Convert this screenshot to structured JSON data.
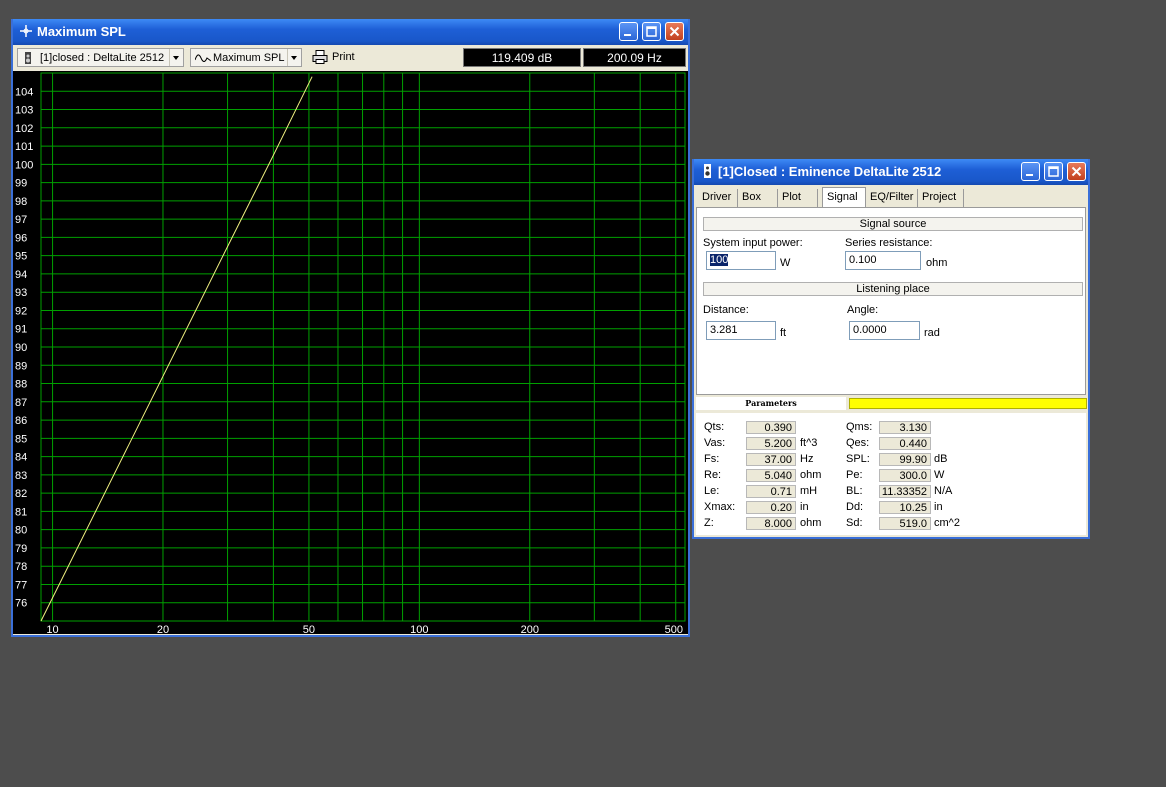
{
  "spl_window": {
    "title": "Maximum SPL",
    "title_icon": "crosshair-icon",
    "toolbar": {
      "driver_select": "[1]closed : DeltaLite 2512",
      "plot_select": "Maximum SPL",
      "print_label": "Print",
      "db_readout": "119.409 dB",
      "hz_readout": "200.09 Hz"
    }
  },
  "chart_data": {
    "type": "line",
    "title": "",
    "xlabel": "",
    "ylabel": "",
    "x_scale": "log",
    "xlim": [
      9.3,
      530
    ],
    "ylim": [
      75,
      105
    ],
    "x_tick_labels": [
      {
        "value": 10,
        "label": "10"
      },
      {
        "value": 20,
        "label": "20"
      },
      {
        "value": 50,
        "label": "50"
      },
      {
        "value": 100,
        "label": "100"
      },
      {
        "value": 200,
        "label": "200"
      },
      {
        "value": 500,
        "label": "500"
      }
    ],
    "y_ticks": [
      76,
      77,
      78,
      79,
      80,
      81,
      82,
      83,
      84,
      85,
      86,
      87,
      88,
      89,
      90,
      91,
      92,
      93,
      94,
      95,
      96,
      97,
      98,
      99,
      100,
      101,
      102,
      103,
      104
    ],
    "grid": true,
    "background": "#000000",
    "grid_color": "#00a000",
    "axis_text_color": "#ffffff",
    "series": [
      {
        "color": "#f0f080",
        "x": [
          9.3,
          20,
          30,
          40,
          51
        ],
        "y": [
          75,
          88.4,
          95.5,
          100.5,
          104.8
        ]
      }
    ]
  },
  "signal_window": {
    "title": "[1]Closed : Eminence  DeltaLite 2512",
    "title_icon": "speaker-icon",
    "tabs": [
      {
        "label": "Driver"
      },
      {
        "label": "Box"
      },
      {
        "label": "Plot"
      },
      {
        "label": "Signal",
        "active": true
      },
      {
        "label": "EQ/Filter"
      },
      {
        "label": "Project"
      }
    ],
    "signal_source": {
      "header": "Signal source",
      "power_label": "System input power:",
      "power_value": "100",
      "power_unit": "W",
      "resistance_label": "Series resistance:",
      "resistance_value": "0.100",
      "resistance_unit": "ohm"
    },
    "listening_place": {
      "header": "Listening place",
      "distance_label": "Distance:",
      "distance_value": "3.281",
      "distance_unit": "ft",
      "angle_label": "Angle:",
      "angle_value": "0.0000",
      "angle_unit": "rad"
    },
    "parameters_header": "Parameters",
    "parameters_left": [
      {
        "name": "Qts:",
        "value": "0.390",
        "unit": ""
      },
      {
        "name": "Vas:",
        "value": "5.200",
        "unit": "ft^3"
      },
      {
        "name": "Fs:",
        "value": "37.00",
        "unit": "Hz"
      },
      {
        "name": "Re:",
        "value": "5.040",
        "unit": "ohm"
      },
      {
        "name": "Le:",
        "value": "0.71",
        "unit": "mH"
      },
      {
        "name": "Xmax:",
        "value": "0.20",
        "unit": "in"
      },
      {
        "name": "Z:",
        "value": "8.000",
        "unit": "ohm"
      }
    ],
    "parameters_right": [
      {
        "name": "Qms:",
        "value": "3.130",
        "unit": ""
      },
      {
        "name": "Qes:",
        "value": "0.440",
        "unit": ""
      },
      {
        "name": "SPL:",
        "value": "99.90",
        "unit": "dB"
      },
      {
        "name": "Pe:",
        "value": "300.0",
        "unit": "W"
      },
      {
        "name": "BL:",
        "value": "11.33352",
        "unit": "N/A"
      },
      {
        "name": "Dd:",
        "value": "10.25",
        "unit": "in"
      },
      {
        "name": "Sd:",
        "value": "519.0",
        "unit": "cm^2"
      }
    ]
  }
}
